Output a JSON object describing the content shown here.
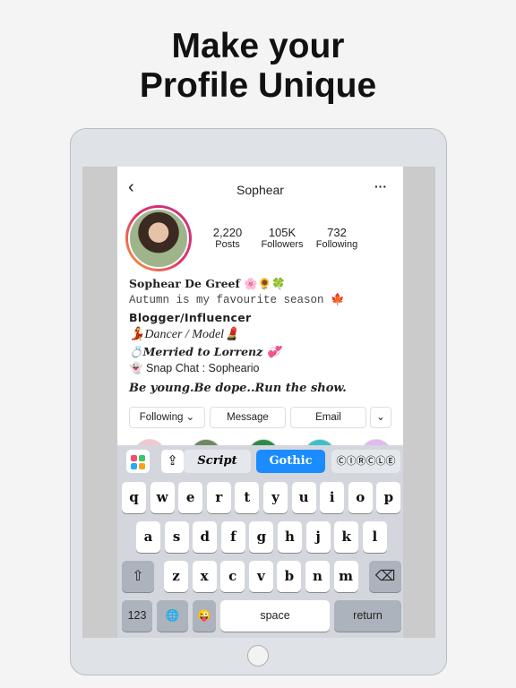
{
  "headline": {
    "line1": "Make your",
    "line2": "Profile Unique"
  },
  "profile": {
    "username": "Sophear",
    "back_icon": "chevron-left-icon",
    "more_icon": "ellipsis-icon",
    "stats": [
      {
        "value": "2,220",
        "label": "Posts"
      },
      {
        "value": "105K",
        "label": "Followers"
      },
      {
        "value": "732",
        "label": "Following"
      }
    ],
    "bio": [
      "Sophear De Greef 🌸🌻🍀",
      "Autumn is my favourite season 🍁",
      "Blogger/Influencer",
      "💃Dancer / Model💄",
      "💍Merried to Lorrenz 💞",
      "👻 Snap Chat : Sophear­io",
      "Be young.Be dope..Run the show."
    ],
    "buttons": {
      "following": "Following ⌄",
      "message": "Message",
      "email": "Email",
      "more": "⌄"
    }
  },
  "keyboard": {
    "toolbar": {
      "apps_icon": "apps-grid-icon",
      "share_icon": "share-icon",
      "fonts": [
        "Script",
        "Gothic",
        "ⒸⒾⓇⒸⓁⒺ"
      ],
      "selected": "Gothic",
      "accent": "#1a8cff"
    },
    "row1": [
      "q",
      "w",
      "e",
      "r",
      "t",
      "y",
      "u",
      "i",
      "o",
      "p"
    ],
    "row2": [
      "a",
      "s",
      "d",
      "f",
      "g",
      "h",
      "j",
      "k",
      "l"
    ],
    "row3": [
      "z",
      "x",
      "c",
      "v",
      "b",
      "n",
      "m"
    ],
    "shift": "⇧",
    "delete": "⌫",
    "numbers": "123",
    "globe": "🌐",
    "emoji": "😜",
    "space": "space",
    "return": "return"
  }
}
